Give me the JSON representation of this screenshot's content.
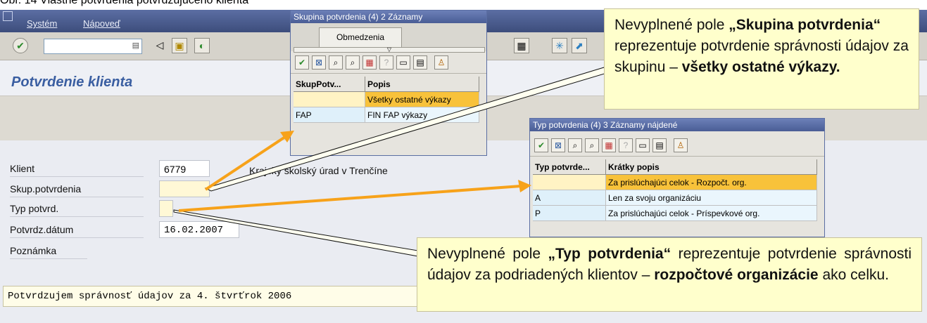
{
  "caption": "Obr. 14 Vlastné potvrdenia potvrdzujúceho klienta",
  "menubar": {
    "items": [
      "Systém",
      "Nápoveď"
    ]
  },
  "toolbar": {
    "cmd_value": ""
  },
  "page_title": "Potvrdenie klienta",
  "form": {
    "rows": [
      {
        "label": "Klient",
        "value": "6779"
      },
      {
        "label": "Skup.potvrdenia",
        "value": ""
      },
      {
        "label": "Typ potvrd.",
        "value": ""
      },
      {
        "label": "Potvrdz.dátum",
        "value": "16.02.2007"
      },
      {
        "label": "Poznámka",
        "value": ""
      }
    ],
    "client_desc": "Krajský školský úrad v Trenčíne",
    "note_value": "Potvrdzujem správnosť údajov za 4. štvrťrok 2006"
  },
  "popup1": {
    "title": "Skupina potvrdenia (4)   2 Záznamy",
    "tab": "Obmedzenia",
    "headers": [
      "SkupPotv...",
      "Popis"
    ],
    "rows": [
      [
        "",
        "Všetky ostatné výkazy"
      ],
      [
        "FAP",
        "FIN FAP výkazy"
      ]
    ]
  },
  "popup2": {
    "title": "Typ potvrdenia (4)   3 Záznamy nájdené",
    "headers": [
      "Typ potvrde...",
      "Krátky popis"
    ],
    "rows": [
      [
        "",
        "Za prislúchajúci celok - Rozpočt. org."
      ],
      [
        "A",
        "Len za svoju organizáciu"
      ],
      [
        "P",
        "Za prislúchajúci celok - Príspevkové org."
      ]
    ]
  },
  "callout1": {
    "t1": "Nevyplnené pole ",
    "b1": "„Skupina potvrdenia“",
    "t2": " reprezentuje potvrdenie správnosti údajov za skupinu – ",
    "b2": "všetky ostatné výkazy."
  },
  "callout2": {
    "t1": "Nevyplnené pole ",
    "b1": "„Typ potvrdenia“",
    "t2": " reprezentuje potvrdenie správnosti údajov za podriadených klientov – ",
    "b2": "rozpočtové organizácie",
    "t3": " ako celku."
  },
  "colors": {
    "callout_bg": "#ffffcc",
    "arrow": "#f7a21a",
    "highlight": "#f8c23a",
    "title_blue": "#3a5ea1"
  }
}
